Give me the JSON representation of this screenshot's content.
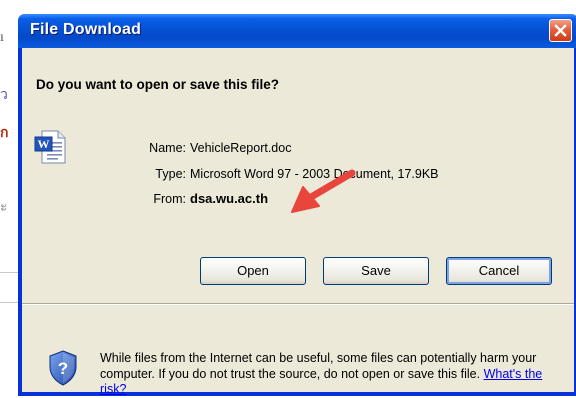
{
  "background": {
    "fragments": [
      "ı",
      "ว",
      "ก",
      "ะ"
    ]
  },
  "dialog": {
    "title": "File Download",
    "question": "Do you want to open or save this file?",
    "fields": {
      "name_label": "Name:",
      "name_value": "VehicleReport.doc",
      "type_label": "Type:",
      "type_value": "Microsoft Word 97 - 2003 Document, 17.9KB",
      "from_label": "From:",
      "from_value": "dsa.wu.ac.th"
    },
    "buttons": {
      "open": "Open",
      "save": "Save",
      "cancel": "Cancel"
    },
    "warning": {
      "text": "While files from the Internet can be useful, some files can potentially harm your computer. If you do not trust the source, do not open or save this file.",
      "link": "What's the risk?"
    }
  },
  "icons": {
    "close": "close-icon",
    "document": "word-document-icon",
    "shield": "security-shield-icon",
    "annotation": "red-arrow-annotation"
  },
  "colors": {
    "titlebar": "#0653d6",
    "client": "#ece9d8",
    "close_button": "#e5603d",
    "arrow": "#e8453c",
    "link": "#0000ee"
  }
}
